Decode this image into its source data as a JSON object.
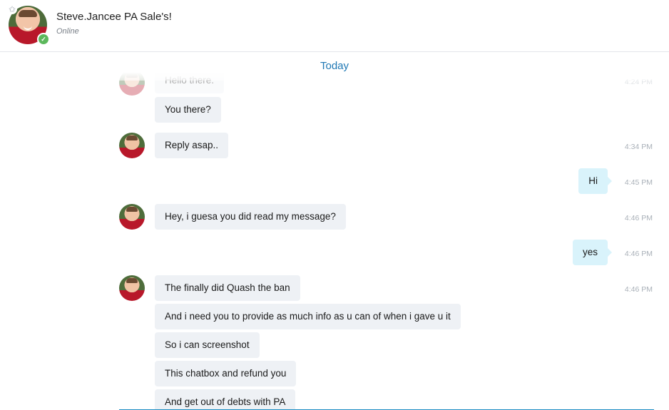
{
  "header": {
    "contact_name": "Steve.Jancee PA Sale's!",
    "status": "Online",
    "favorite_icon": "star-icon",
    "online_icon": "check-icon",
    "status_color": "#5cb85c"
  },
  "day_divider": "Today",
  "messages": [
    {
      "sender": "contact",
      "text": "Hello there.",
      "time": "4:24 PM"
    },
    {
      "sender": "contact",
      "text": "You there?",
      "time": ""
    },
    {
      "sender": "contact",
      "text": "Reply asap..",
      "time": "4:34 PM"
    },
    {
      "sender": "me",
      "text": "Hi",
      "time": "4:45 PM"
    },
    {
      "sender": "contact",
      "text": "Hey, i guesa you did read my message?",
      "time": "4:46 PM"
    },
    {
      "sender": "me",
      "text": "yes",
      "time": "4:46 PM"
    },
    {
      "sender": "contact",
      "text": "The finally did Quash the ban",
      "time": "4:46 PM"
    },
    {
      "sender": "contact",
      "text": "And i need you to provide as much info as u can of when i gave u it",
      "time": ""
    },
    {
      "sender": "contact",
      "text": "So i can screenshot",
      "time": ""
    },
    {
      "sender": "contact",
      "text": "This chatbox and refund you",
      "time": ""
    },
    {
      "sender": "contact",
      "text": "And get out of debts with PA",
      "time": ""
    }
  ],
  "colors": {
    "accent": "#1f78b4",
    "incoming_bubble": "#eef1f5",
    "outgoing_bubble": "#d9f3fb"
  }
}
